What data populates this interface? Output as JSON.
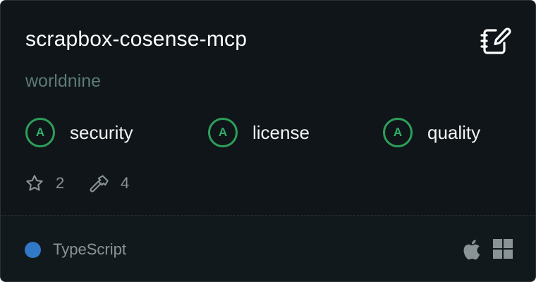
{
  "card": {
    "title": "scrapbox-cosense-mcp",
    "owner": "worldnine",
    "icon": "notebook-pen-icon"
  },
  "grades": [
    {
      "letter": "A",
      "label": "security"
    },
    {
      "letter": "A",
      "label": "license"
    },
    {
      "letter": "A",
      "label": "quality"
    }
  ],
  "stats": {
    "stars": "2",
    "tools": "4"
  },
  "footer": {
    "language": "TypeScript",
    "language_color": "#3178c6",
    "platforms": [
      "apple-icon",
      "windows-icon"
    ]
  },
  "colors": {
    "background": "#0f1518",
    "grade_green": "#2e9e5b",
    "owner_text": "#5d7a76"
  }
}
